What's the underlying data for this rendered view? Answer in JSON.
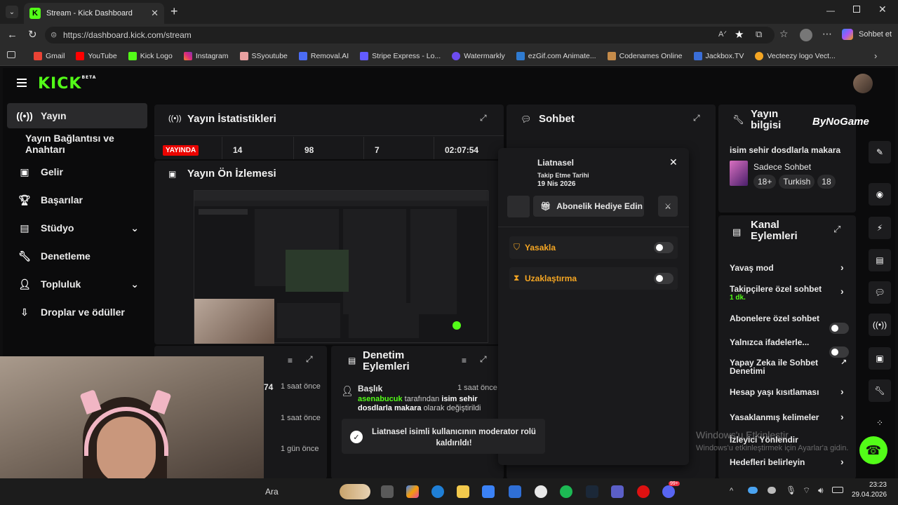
{
  "browser": {
    "tab_title": "Stream - Kick Dashboard",
    "url": "https://dashboard.kick.com/stream",
    "copilot_label": "Sohbet et",
    "bookmarks": [
      "Gmail",
      "YouTube",
      "Kick Logo",
      "Instagram",
      "SSyoutube",
      "Removal.AI",
      "Stripe Express - Lo...",
      "Watermarkly",
      "ezGif.com Animate...",
      "Codenames Online",
      "Jackbox.TV",
      "Vecteezy logo Vect..."
    ]
  },
  "app": {
    "logo": "KICK",
    "logo_sup": "BETA",
    "sidebar": [
      {
        "label": "Yayın",
        "icon": "broadcast-icon"
      },
      {
        "label": "Yayın Bağlantısı ve Anahtarı",
        "icon": ""
      },
      {
        "label": "Gelir",
        "icon": "money-icon"
      },
      {
        "label": "Başarılar",
        "icon": "trophy-icon"
      },
      {
        "label": "Stüdyo",
        "icon": "studio-icon"
      },
      {
        "label": "Denetleme",
        "icon": "wrench-icon"
      },
      {
        "label": "Topluluk",
        "icon": "community-icon"
      },
      {
        "label": "Droplar ve ödüller",
        "icon": "drops-icon"
      }
    ],
    "stats": {
      "title": "Yayın İstatistikleri",
      "live": "YAYINDA",
      "values": [
        "14",
        "98",
        "7",
        "02:07:54"
      ]
    },
    "preview": {
      "title": "Yayın Ön İzlemesi"
    },
    "chat": {
      "title": "Sohbet"
    },
    "user_popup": {
      "name": "Liatnasel",
      "follow_label": "Takip Etme Tarihi",
      "follow_date": "19 Nis 2026",
      "gift_sub": "Abonelik Hediye Edin",
      "ban": "Yasakla",
      "timeout": "Uzaklaştırma"
    },
    "stream_info": {
      "title": "Yayın bilgisi",
      "watermark": "ByNoGame",
      "stream_title": "isim sehir dosdlarla makara",
      "category": "Sadece Sohbet",
      "tags": [
        "18+",
        "Turkish",
        "18"
      ]
    },
    "channel_actions": {
      "title": "Kanal Eylemleri",
      "items": [
        {
          "label": "Yavaş mod",
          "type": "arrow"
        },
        {
          "label": "Takipçilere özel sohbet",
          "sub": "1 dk.",
          "type": "arrow"
        },
        {
          "label": "Abonelere özel sohbet",
          "type": "toggle"
        },
        {
          "label": "Yalnızca ifadelerle...",
          "type": "toggle"
        },
        {
          "label": "Yapay Zeka ile Sohbet Denetimi",
          "type": "external"
        },
        {
          "label": "Hesap yaşı kısıtlaması",
          "type": "arrow"
        },
        {
          "label": "Yasaklanmış kelimeler",
          "type": "arrow"
        },
        {
          "label": "İzleyici Yönlendir",
          "type": "none"
        },
        {
          "label": "Hedefleri belirleyin",
          "type": "arrow"
        }
      ]
    },
    "mod_actions": {
      "title": "Denetim Eylemleri",
      "entry_title": "Başlık",
      "entry_time": "1 saat önce",
      "entry_user": "asenabucuk",
      "entry_mid": "tarafından",
      "entry_value": "isim sehir dosdlarla makara",
      "entry_end": "olarak değiştirildi"
    },
    "events": {
      "rows": [
        {
          "value": "74",
          "time": "1 saat önce"
        },
        {
          "value": "",
          "time": "1 saat önce"
        },
        {
          "value": "",
          "time": "1 gün önce"
        }
      ]
    },
    "toast": "Liatnasel isimli kullanıcının moderator rolü kaldırıldı!",
    "windows_watermark": {
      "line1": "Windows'u Etkinleştir",
      "line2": "Windows'u etkinleştirmek için Ayarlar'a gidin."
    }
  },
  "taskbar": {
    "search": "Ara",
    "time": "23:23",
    "date": "29.04.2026",
    "badge": "99+"
  },
  "colors": {
    "kick_green": "#53fc18",
    "live_red": "#eb0400",
    "warn_orange": "#f5a623"
  }
}
